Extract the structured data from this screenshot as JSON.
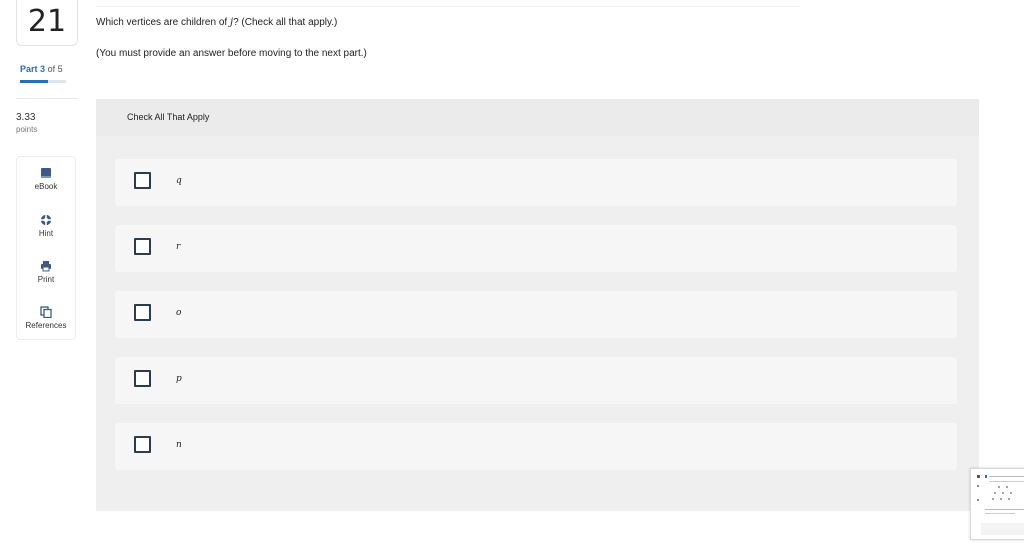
{
  "question": {
    "number": "21",
    "prompt_prefix": "Which vertices are children of ",
    "prompt_var": "j",
    "prompt_suffix": "? (Check all that apply.)",
    "note": "(You must provide an answer before moving to the next part.)"
  },
  "part": {
    "prefix": "Part",
    "current": "3",
    "of": "of 5",
    "progress": 0.6
  },
  "points": {
    "value": "3.33",
    "unit": "points"
  },
  "tools": [
    {
      "label": "eBook",
      "icon": "book-icon"
    },
    {
      "label": "Hint",
      "icon": "lifebuoy-icon"
    },
    {
      "label": "Print",
      "icon": "printer-icon"
    },
    {
      "label": "References",
      "icon": "copy-icon"
    }
  ],
  "panel": {
    "title": "Check All That Apply",
    "options": [
      {
        "label": "q",
        "checked": false
      },
      {
        "label": "r",
        "checked": false
      },
      {
        "label": "o",
        "checked": false
      },
      {
        "label": "p",
        "checked": false
      },
      {
        "label": "n",
        "checked": false
      }
    ]
  },
  "colors": {
    "accent": "#2a6fb5",
    "checkbox_border": "#2b3c4c",
    "panel_bg": "#efefef"
  }
}
